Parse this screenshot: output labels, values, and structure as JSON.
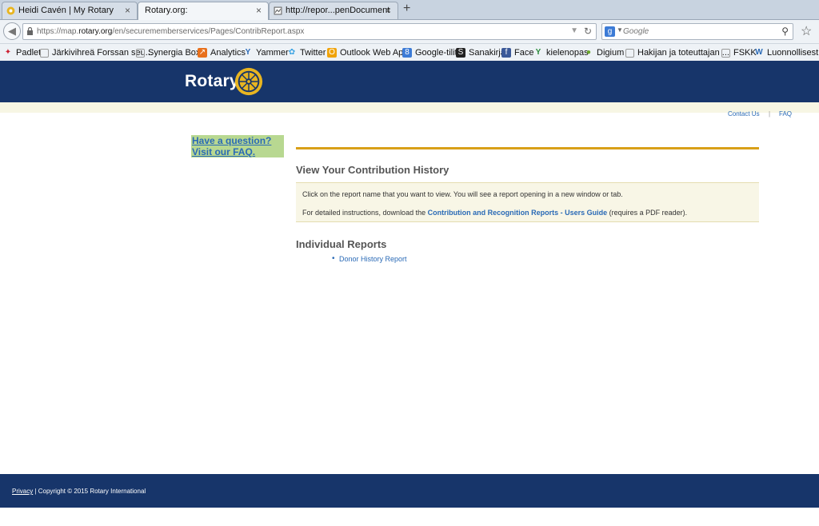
{
  "browser": {
    "tabs": [
      {
        "title": "Heidi Cavén | My Rotary",
        "close": "×"
      },
      {
        "title": "Rotary.org:",
        "close": "×"
      },
      {
        "title": "http://repor...penDocument",
        "close": "×"
      }
    ],
    "new_tab": "+",
    "url_prefix": "https://map.",
    "url_domain": "rotary.org",
    "url_path": "/en/securememberservices/Pages/ContribReport.aspx",
    "search_placeholder": "Google",
    "bookmarks": [
      "Padlet",
      "Järkivihreä Forssan seu...",
      "Synergia Boxy",
      "Analytics",
      "Yammer",
      "Twitter",
      "Outlook Web App",
      "Google-tilit",
      "Sanakirja",
      "Face",
      "kielenopas",
      "Digium",
      "Hakijan ja toteuttajan ...",
      "FSKK",
      "Luonnollisesti il"
    ]
  },
  "site": {
    "logo_text": "Rotary",
    "utility_links": {
      "contact": "Contact Us",
      "separator": "|",
      "faq": "FAQ"
    },
    "faq_box": {
      "line1": "Have a question?",
      "line2": "Visit our FAQ."
    },
    "heading_view": "View Your Contribution History",
    "notice": {
      "line1": "Click on the report name that you want to view. You will see a report opening in a new window or tab.",
      "line2_prefix": "For detailed instructions, download the ",
      "line2_link": "Contribution and Recognition Reports - Users Guide",
      "line2_suffix": " (requires a PDF reader)."
    },
    "heading_individual": "Individual Reports",
    "reports": [
      "Donor History Report"
    ],
    "footer": {
      "privacy": "Privacy",
      "copyright": " | Copyright © 2015 Rotary International"
    }
  },
  "colors": {
    "navy": "#17356a",
    "gold": "#d9a018",
    "link": "#2a6ab6",
    "faq_green": "#b8d891"
  }
}
